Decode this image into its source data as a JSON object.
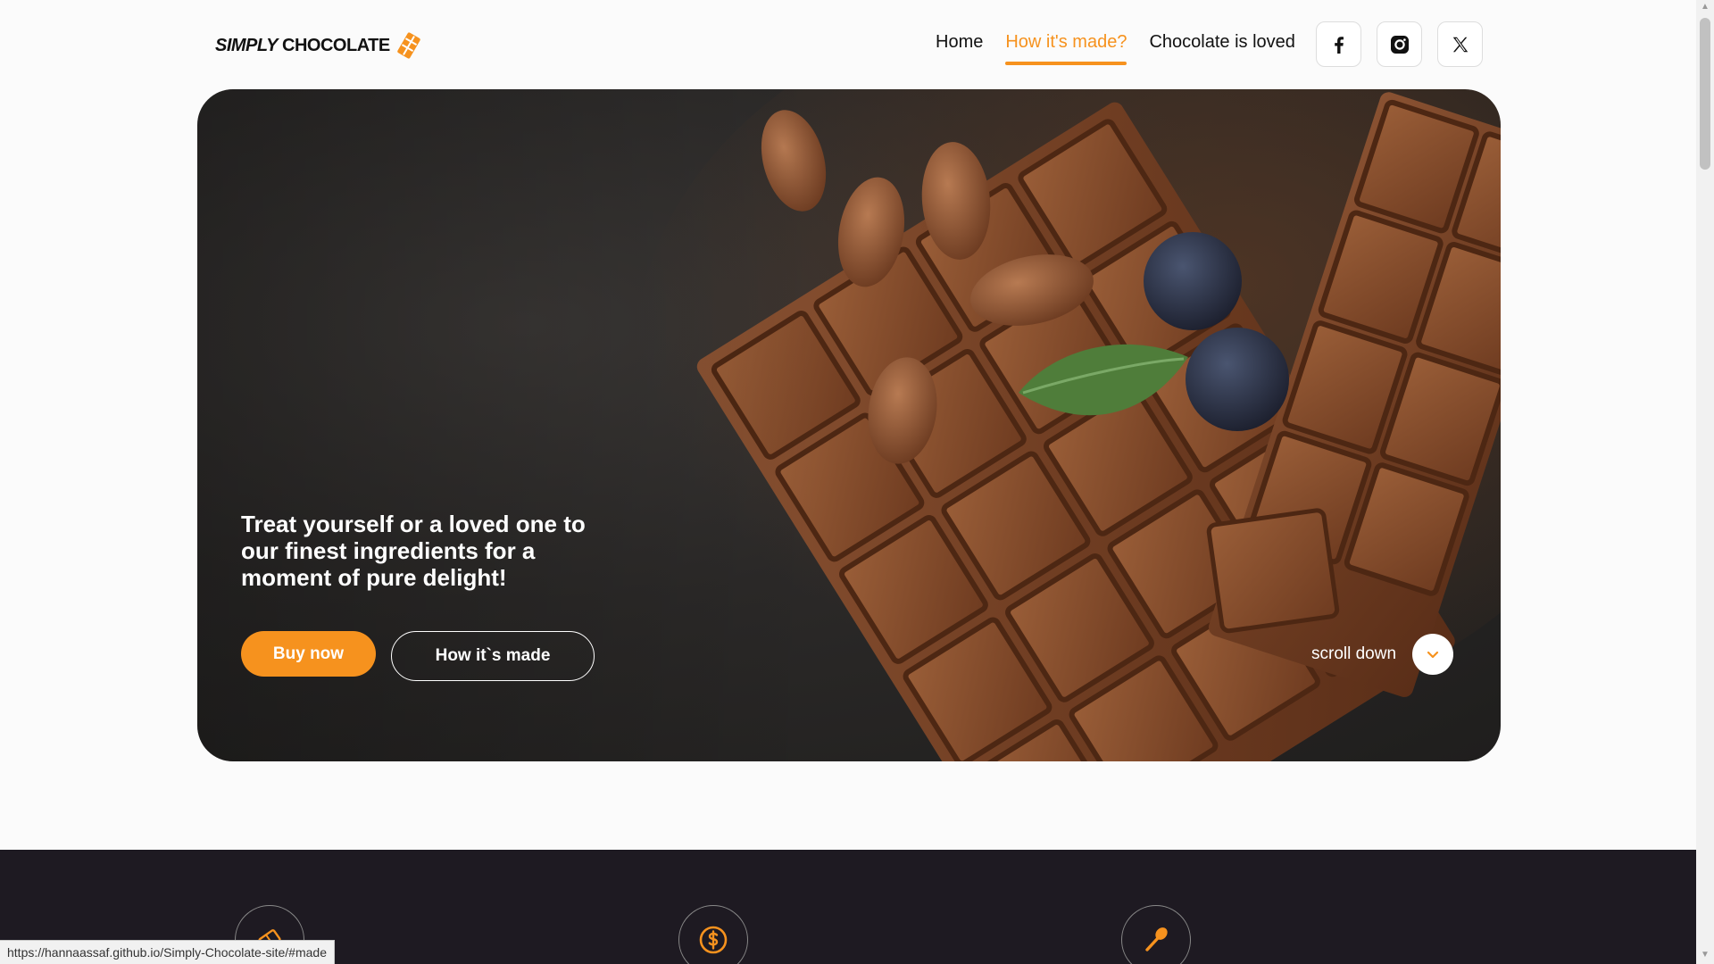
{
  "header": {
    "logo_part1": "SIMPLY",
    "logo_part2": "CHOCOLATE",
    "nav": [
      {
        "label": "Home",
        "active": false
      },
      {
        "label": "How it's made?",
        "active": true
      },
      {
        "label": "Chocolate is loved",
        "active": false
      }
    ],
    "socials": [
      "facebook-icon",
      "instagram-icon",
      "x-twitter-icon"
    ]
  },
  "hero": {
    "tagline": "Treat yourself or a loved one to our finest ingredients for a moment of pure delight!",
    "buy_label": "Buy now",
    "how_label": "How it`s made",
    "scroll_label": "scroll down"
  },
  "features": [
    "chocolate-icon",
    "dollar-icon",
    "spoon-icon"
  ],
  "status_url": "https://hannaassaf.github.io/Simply-Chocolate-site/#made",
  "colors": {
    "accent": "#f6921e",
    "dark_band": "#1e1a22"
  }
}
